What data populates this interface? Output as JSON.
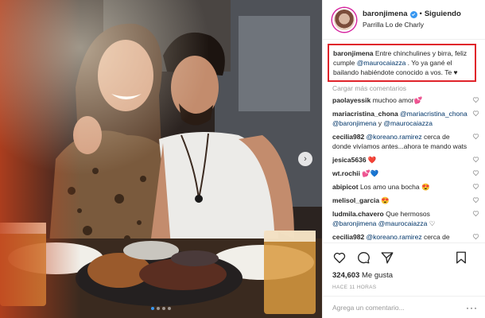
{
  "post": {
    "dots_count": 4,
    "active_dot": 0,
    "next_icon": "chevron-right-icon"
  },
  "header": {
    "username": "baronjimena",
    "separator": "•",
    "follow_label": "Siguiendo",
    "location": "Parrilla Lo de Charly"
  },
  "caption": {
    "username": "baronjimena",
    "text_before": " Entre chinchulines y birra, feliz cumple ",
    "mention": "@maurocaiazza",
    "text_after": " . Yo ya gané el bailando habiéndote conocido a vos. Te ♥"
  },
  "load_more": "Cargar más comentarios",
  "comments": [
    {
      "user": "paolayessik",
      "parts": [
        {
          "t": "text",
          "v": " muchoo amor💕"
        }
      ]
    },
    {
      "user": "mariacristina_chona",
      "parts": [
        {
          "t": "mention",
          "v": " @mariacristina_chona"
        },
        {
          "t": "mention",
          "v": " @baronjimena"
        },
        {
          "t": "text",
          "v": " y "
        },
        {
          "t": "mention",
          "v": "@maurocaiazza"
        }
      ]
    },
    {
      "user": "cecilia982",
      "parts": [
        {
          "t": "mention",
          "v": " @koreano.ramirez"
        },
        {
          "t": "text",
          "v": " cerca de donde vivíamos antes...ahora te mando wats"
        }
      ]
    },
    {
      "user": "jesica5636",
      "parts": [
        {
          "t": "text",
          "v": " ❤️"
        }
      ]
    },
    {
      "user": "wt.rochii",
      "parts": [
        {
          "t": "text",
          "v": " 💕💙"
        }
      ]
    },
    {
      "user": "abipicot",
      "parts": [
        {
          "t": "text",
          "v": " Los amo una bocha 😍"
        }
      ]
    },
    {
      "user": "melisol_garcia",
      "parts": [
        {
          "t": "text",
          "v": " 😍"
        }
      ]
    },
    {
      "user": "ludmila.chavero",
      "parts": [
        {
          "t": "text",
          "v": " Que hermosos "
        },
        {
          "t": "mention",
          "v": "@baronjimena"
        },
        {
          "t": "text",
          "v": " "
        },
        {
          "t": "mention",
          "v": "@maurocaiazza"
        },
        {
          "t": "text",
          "v": " ♡"
        }
      ]
    },
    {
      "user": "cecilia982",
      "parts": [
        {
          "t": "mention",
          "v": " @koreano.ramirez"
        },
        {
          "t": "text",
          "v": " cerca de donde vivíamos antes"
        }
      ]
    }
  ],
  "actions": {
    "likes_count": "324,603",
    "likes_label": "Me gusta",
    "time_ago": "HACE 11 HORAS"
  },
  "add_comment": {
    "placeholder": "Agrega un comentario...",
    "more_label": "···"
  },
  "colors": {
    "accent_blue": "#3897f0",
    "mention_blue": "#003569",
    "highlight_red": "#e0242b",
    "heart_red": "#ed4956"
  }
}
